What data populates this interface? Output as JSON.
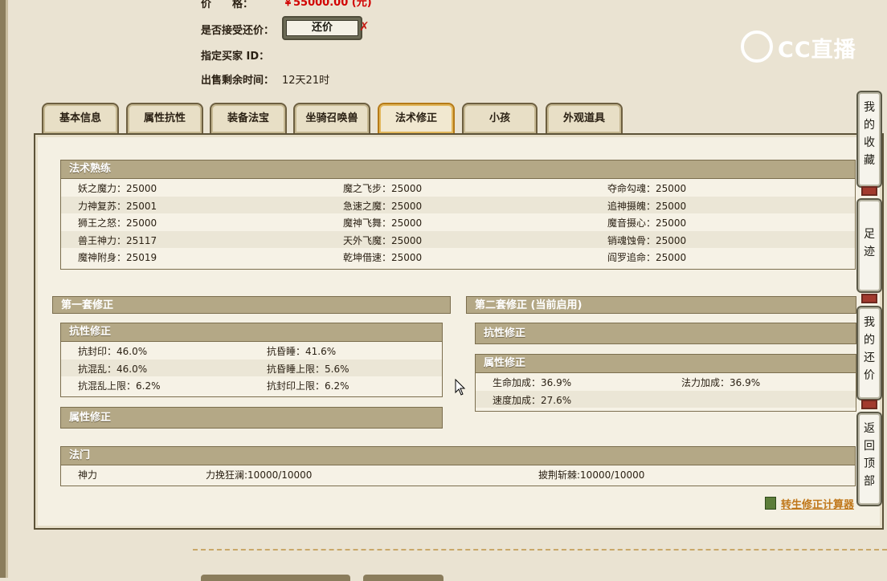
{
  "top_info": {
    "price_label": "价　　格：",
    "price_value": "￥55000.00 (元)",
    "counter_label": "是否接受还价：",
    "counter_button": "还价",
    "counter_mark": "✗",
    "buyer_label": "指定买家 ID：",
    "remaining_label": "出售剩余时间：",
    "remaining_value": "12天21时"
  },
  "logo": {
    "text": "CC直播"
  },
  "tabs": [
    {
      "label": "基本信息"
    },
    {
      "label": "属性抗性"
    },
    {
      "label": "装备法宝"
    },
    {
      "label": "坐骑召唤兽"
    },
    {
      "label": "法术修正",
      "active": true
    },
    {
      "label": "小孩"
    },
    {
      "label": "外观道具"
    }
  ],
  "spell_mastery": {
    "title": "法术熟练",
    "rows": [
      [
        "妖之魔力：25000",
        "魔之飞步：25000",
        "夺命勾魂：25000"
      ],
      [
        "力神复苏：25001",
        "急速之魔：25000",
        "追神摄魄：25000"
      ],
      [
        "狮王之怒：25000",
        "魔神飞舞：25000",
        "魔音摄心：25000"
      ],
      [
        "兽王神力：25117",
        "天外飞魔：25000",
        "销魂蚀骨：25000"
      ],
      [
        "魔神附身：25019",
        "乾坤借速：25000",
        "阎罗追命：25000"
      ]
    ]
  },
  "set1": {
    "title": "第一套修正",
    "resist_title": "抗性修正",
    "resist_rows": [
      [
        "抗封印：46.0%",
        "抗昏睡：41.6%"
      ],
      [
        "抗混乱：46.0%",
        "抗昏睡上限：5.6%"
      ],
      [
        "抗混乱上限：6.2%",
        "抗封印上限：6.2%"
      ]
    ],
    "attr_title": "属性修正"
  },
  "set2": {
    "title": "第二套修正 (当前启用)",
    "resist_title": "抗性修正",
    "attr_title": "属性修正",
    "attr_rows": [
      [
        "生命加成：36.9%",
        "法力加成：36.9%"
      ],
      [
        "速度加成：27.6%",
        ""
      ]
    ]
  },
  "famen": {
    "title": "法门",
    "cells": [
      "神力",
      "力挽狂澜:10000/10000",
      "披荆斩棘:10000/10000"
    ]
  },
  "calculator_link": "转生修正计算器",
  "side_buttons": [
    {
      "label": "我的收藏",
      "chars": [
        "我",
        "的",
        "收",
        "藏"
      ]
    },
    {
      "label": "足迹",
      "chars": [
        "足",
        "迹"
      ]
    },
    {
      "label": "我的还价",
      "chars": [
        "我",
        "的",
        "还",
        "价"
      ]
    },
    {
      "label": "返回顶部",
      "chars": [
        "返",
        "回",
        "顶",
        "部"
      ]
    }
  ],
  "colors": {
    "price": "#d10000",
    "section_header": "#b4a886",
    "active_tab_border": "#b57a17",
    "link": "#c0771a"
  }
}
